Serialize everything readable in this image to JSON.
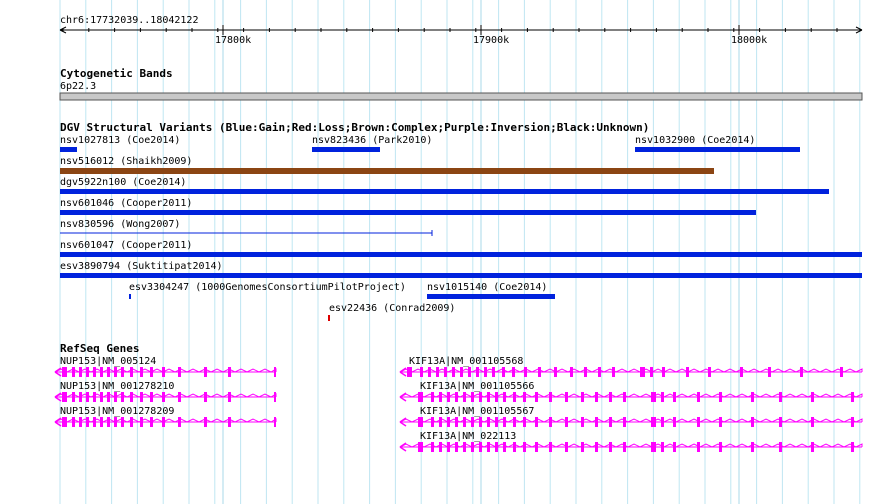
{
  "ruler": {
    "range_label": "chr6:17732039..18042122",
    "ticks": [
      "17800k",
      "17900k",
      "18000k"
    ]
  },
  "cytoband": {
    "title": "Cytogenetic Bands",
    "band_label": "6p22.3"
  },
  "dgv": {
    "title": "DGV Structural Variants (Blue:Gain;Red:Loss;Brown:Complex;Purple:Inversion;Black:Unknown)",
    "colors": {
      "gain": "#0022dd",
      "loss": "#dd0000",
      "complex": "#8b4513",
      "inversion": "#800080",
      "unknown": "#000000"
    },
    "features": [
      {
        "label": "nsv1027813 (Coe2014)"
      },
      {
        "label": "nsv823436 (Park2010)"
      },
      {
        "label": "nsv1032900 (Coe2014)"
      },
      {
        "label": "nsv516012 (Shaikh2009)"
      },
      {
        "label": "dgv5922n100 (Coe2014)"
      },
      {
        "label": "nsv601046 (Cooper2011)"
      },
      {
        "label": "nsv830596 (Wong2007)"
      },
      {
        "label": "nsv601047 (Cooper2011)"
      },
      {
        "label": "esv3890794 (Suktitipat2014)"
      },
      {
        "label": "esv3304247 (1000GenomesConsortiumPilotProject)"
      },
      {
        "label": "nsv1015140 (Coe2014)"
      },
      {
        "label": "esv22436 (Conrad2009)"
      }
    ]
  },
  "refseq": {
    "title": "RefSeq Genes",
    "color": "#ff00ff",
    "transcripts": [
      {
        "label": "NUP153|NM_005124"
      },
      {
        "label": "NUP153|NM_001278210"
      },
      {
        "label": "NUP153|NM_001278209"
      },
      {
        "label": "KIF13A|NM_001105568"
      },
      {
        "label": "KIF13A|NM_001105566"
      },
      {
        "label": "KIF13A|NM_001105567"
      },
      {
        "label": "KIF13A|NM_022113"
      }
    ]
  }
}
